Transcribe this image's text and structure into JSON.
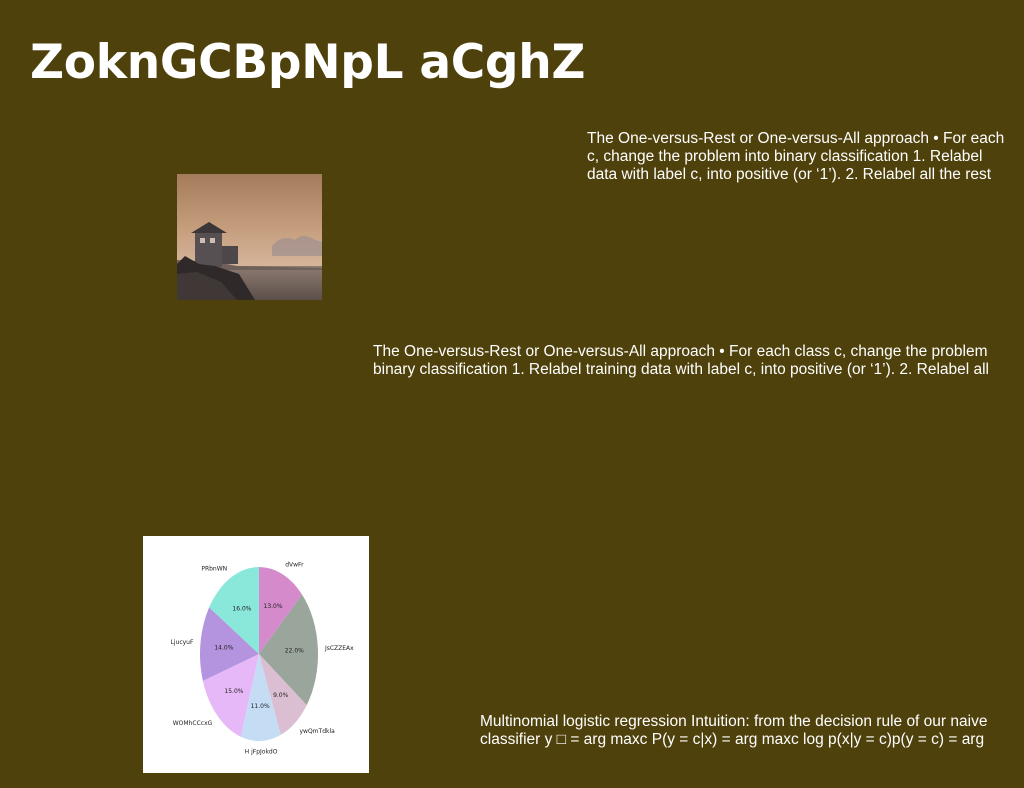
{
  "slide": {
    "title": "ZoknGCBpNpL aCghZ",
    "text_blocks": [
      "The One-versus-Rest or One-versus-All approach • For each\nc, change the problem into binary classification 1. Relabel\ndata with label c, into positive (or ‘1’). 2. Relabel all the rest",
      "The One-versus-Rest or One-versus-All approach • For each class c, change the problem\nbinary classification 1. Relabel training data with label c, into positive (or ‘1’). 2. Relabel all",
      "Multinomial logistic regression Intuition: from the decision rule of our naive\nclassifier y □ = arg maxc P(y = c|x) = arg maxc log p(x|y = c)p(y = c) = arg"
    ]
  },
  "colors": {
    "background": "#4f410c",
    "text": "#ffffff"
  },
  "chart_data": {
    "type": "pie",
    "labels": [
      "dVwFr",
      "JsCZZEAx",
      "ywQmTdkla",
      "H jFpJokdO",
      "WOMhCCcxG",
      "LjucyuF",
      "PRbnWN"
    ],
    "values": [
      13.0,
      22.0,
      9.0,
      11.0,
      15.0,
      14.0,
      16.0
    ],
    "value_labels": [
      "13.0%",
      "22.0%",
      "9.0%",
      "11.0%",
      "15.0%",
      "14.0%",
      "16.0%"
    ],
    "colors": [
      "#d58acb",
      "#9aa59c",
      "#dbbed1",
      "#c4ddf5",
      "#e6b8f7",
      "#b493df",
      "#8ae8da"
    ],
    "start_angle_deg": 90,
    "direction": "clockwise"
  }
}
